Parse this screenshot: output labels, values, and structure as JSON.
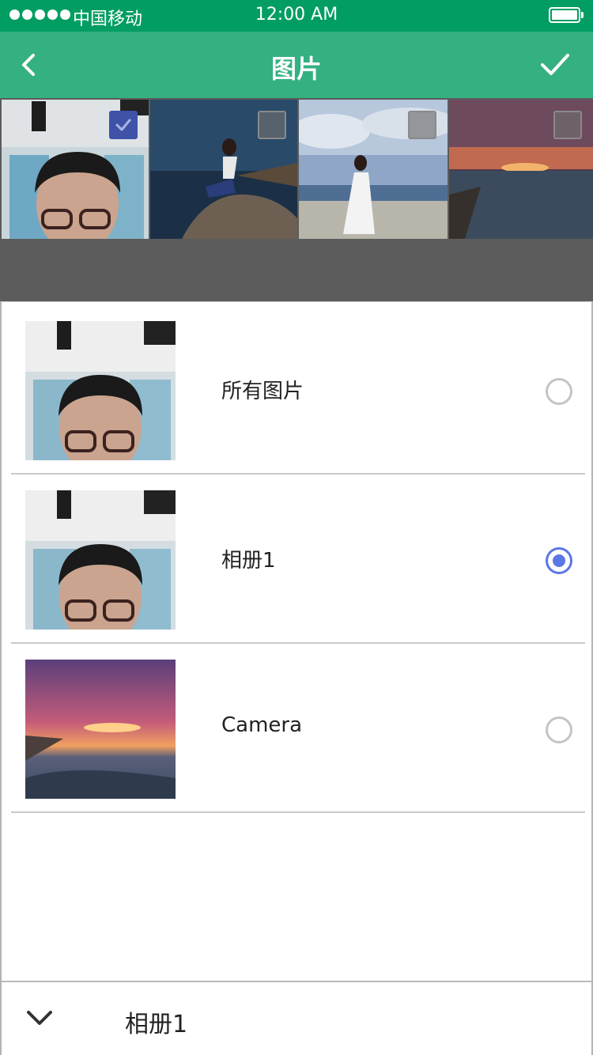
{
  "status_bar": {
    "carrier": "中国移动",
    "time": "12:00 AM"
  },
  "nav": {
    "title": "图片",
    "back_icon": "chevron-left-icon",
    "confirm_icon": "checkmark-icon"
  },
  "photos": [
    {
      "checked": true
    },
    {
      "checked": false
    },
    {
      "checked": false
    },
    {
      "checked": false
    }
  ],
  "albums": [
    {
      "name": "所有图片",
      "selected": false
    },
    {
      "name": "相册1",
      "selected": true
    },
    {
      "name": "Camera",
      "selected": false
    }
  ],
  "bottom_bar": {
    "current_album": "相册1",
    "expand_icon": "chevron-down-icon"
  },
  "colors": {
    "status": "#019d62",
    "nav": "#35b080",
    "accent": "#5b76e6",
    "checked": "#3f52a8"
  }
}
